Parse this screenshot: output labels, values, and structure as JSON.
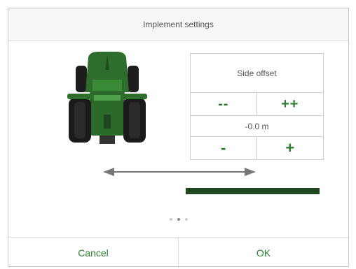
{
  "dialog": {
    "title": "Implement settings"
  },
  "side_offset": {
    "label": "Side offset",
    "decrease_large": "--",
    "increase_large": "++",
    "value": "-0.0 m",
    "decrease_small": "-",
    "increase_small": "+"
  },
  "pager": {
    "pages": 3,
    "active_page": 2
  },
  "footer": {
    "cancel_label": "Cancel",
    "ok_label": "OK"
  },
  "colors": {
    "accent_green": "#2e7d32",
    "implement_bar": "#1e4620",
    "tractor_body": "#2e6b2b"
  },
  "icons": {
    "tractor": "tractor-rear-view-icon",
    "offset_arrow": "double-arrow-icon"
  }
}
